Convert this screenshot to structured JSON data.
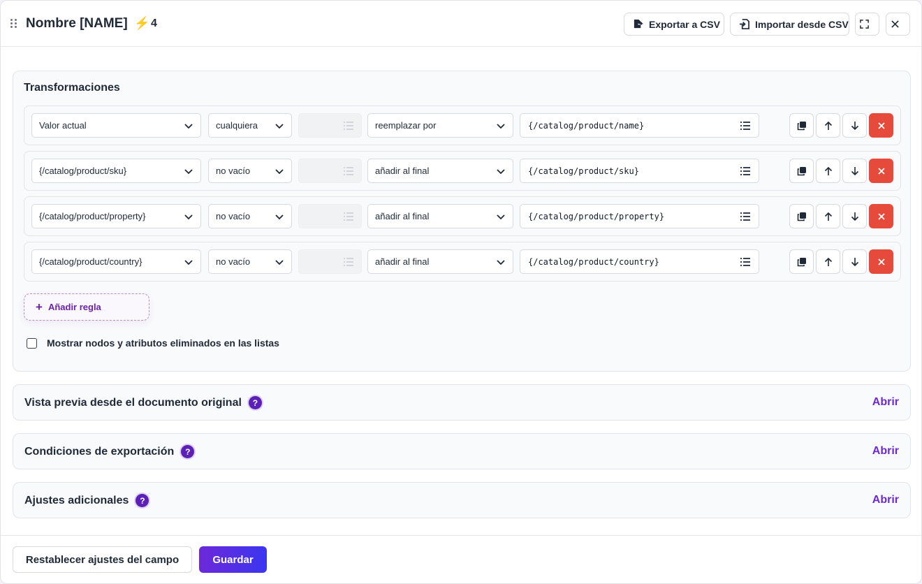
{
  "header": {
    "title": "Nombre [NAME]",
    "badge_count": "4",
    "export_label": "Exportar a CSV",
    "import_label": "Importar desde CSV"
  },
  "transformations": {
    "title": "Transformaciones",
    "rules": [
      {
        "source": "Valor actual",
        "condition": "cualquiera",
        "action": "reemplazar por",
        "value": "{/catalog/product/name}"
      },
      {
        "source": "{/catalog/product/sku}",
        "condition": "no vacío",
        "action": "añadir al final",
        "value": "{/catalog/product/sku}"
      },
      {
        "source": "{/catalog/product/property}",
        "condition": "no vacío",
        "action": "añadir al final",
        "value": "{/catalog/product/property}"
      },
      {
        "source": "{/catalog/product/country}",
        "condition": "no vacío",
        "action": "añadir al final",
        "value": "{/catalog/product/country}"
      }
    ],
    "add_rule_label": "Añadir regla",
    "show_deleted_label": "Mostrar nodos y atributos eliminados en las listas",
    "show_deleted_checked": false
  },
  "sections": [
    {
      "title": "Vista previa desde el documento original",
      "action": "Abrir"
    },
    {
      "title": "Condiciones de exportación",
      "action": "Abrir"
    },
    {
      "title": "Ajustes adicionales",
      "action": "Abrir"
    }
  ],
  "footer": {
    "reset_label": "Restablecer ajustes del campo",
    "save_label": "Guardar"
  },
  "colors": {
    "accent": "#6d28d9",
    "danger": "#e64a3b",
    "bolt": "#f5b301"
  }
}
